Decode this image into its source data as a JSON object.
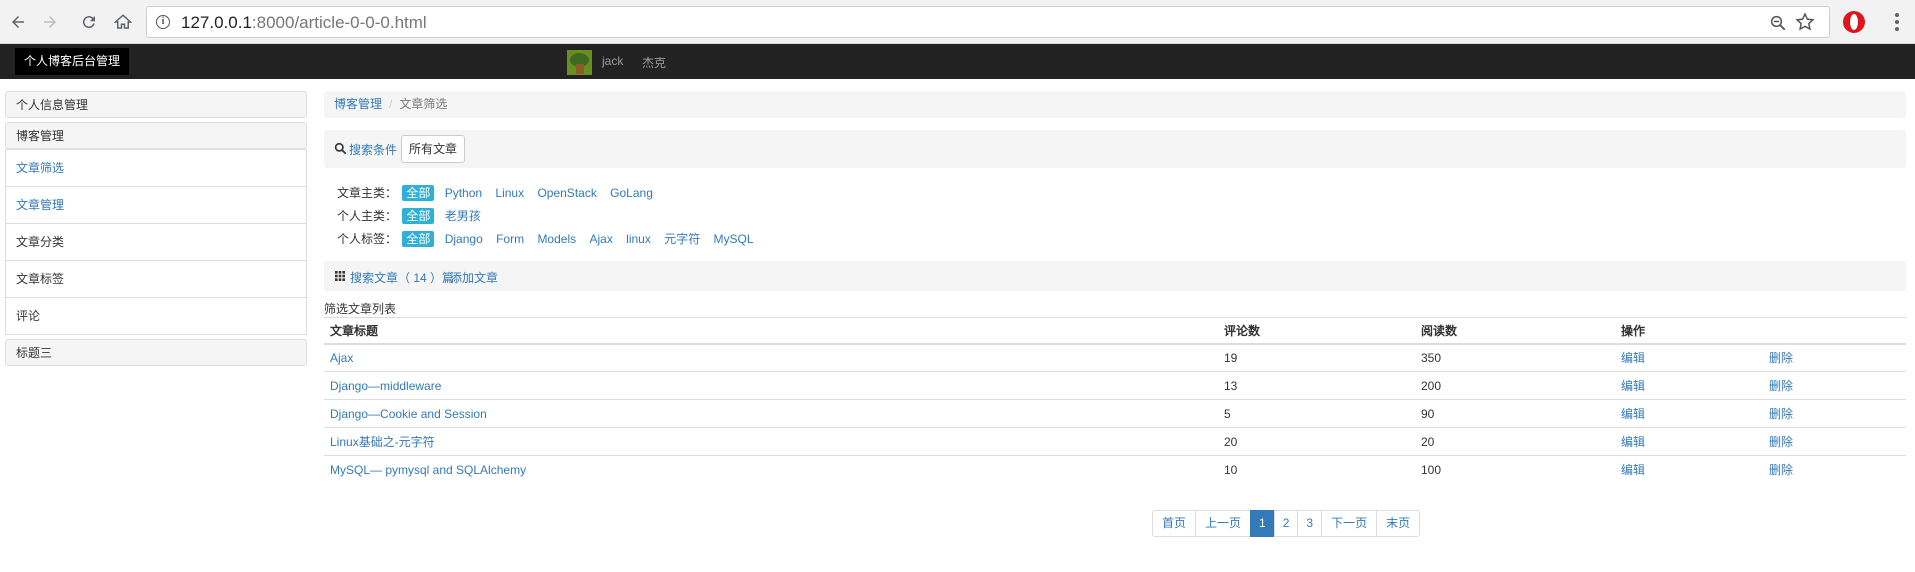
{
  "browser": {
    "url_host": "127.0.0.1",
    "url_rest": ":8000/article-0-0-0.html"
  },
  "navbar": {
    "brand": "个人博客后台管理",
    "user_name": "jack",
    "user_nick": "杰克"
  },
  "sidebar": {
    "personal_info": "个人信息管理",
    "blog_manage": "博客管理",
    "items": [
      {
        "label": "文章筛选",
        "link": true
      },
      {
        "label": "文章管理",
        "link": true
      },
      {
        "label": "文章分类",
        "link": false
      },
      {
        "label": "文章标签",
        "link": false
      },
      {
        "label": "评论",
        "link": false
      }
    ],
    "title_three": "标题三"
  },
  "breadcrumb": {
    "parent": "博客管理",
    "separator": "/",
    "current": "文章筛选"
  },
  "search": {
    "label": "搜索条件",
    "all_button": "所有文章"
  },
  "filters": {
    "main_category": {
      "label": "文章主类：",
      "tags": [
        "全部",
        "Python",
        "Linux",
        "OpenStack",
        "GoLang"
      ]
    },
    "personal_category": {
      "label": "个人主类：",
      "tags": [
        "全部",
        "老男孩"
      ]
    },
    "personal_tags": {
      "label": "个人标签：",
      "tags": [
        "全部",
        "Django",
        "Form",
        "Models",
        "Ajax",
        "linux",
        "元字符",
        "MySQL"
      ]
    }
  },
  "results": {
    "text": "搜索文章（ 14 ）篇",
    "add_link": "添加文章"
  },
  "table": {
    "caption": "筛选文章列表",
    "headers": [
      "文章标题",
      "评论数",
      "阅读数",
      "操作",
      ""
    ],
    "rows": [
      {
        "title": "Ajax",
        "comments": "19",
        "views": "350",
        "edit": "编辑",
        "delete": "删除"
      },
      {
        "title": "Django—middleware",
        "comments": "13",
        "views": "200",
        "edit": "编辑",
        "delete": "删除"
      },
      {
        "title": "Django—Cookie and Session",
        "comments": "5",
        "views": "90",
        "edit": "编辑",
        "delete": "删除"
      },
      {
        "title": "Linux基础之-元字符",
        "comments": "20",
        "views": "20",
        "edit": "编辑",
        "delete": "删除"
      },
      {
        "title": "MySQL— pymysql and SQLAlchemy",
        "comments": "10",
        "views": "100",
        "edit": "编辑",
        "delete": "删除"
      }
    ]
  },
  "pagination": {
    "first": "首页",
    "prev": "上一页",
    "pages": [
      "1",
      "2",
      "3"
    ],
    "current": "1",
    "next": "下一页",
    "last": "末页"
  }
}
